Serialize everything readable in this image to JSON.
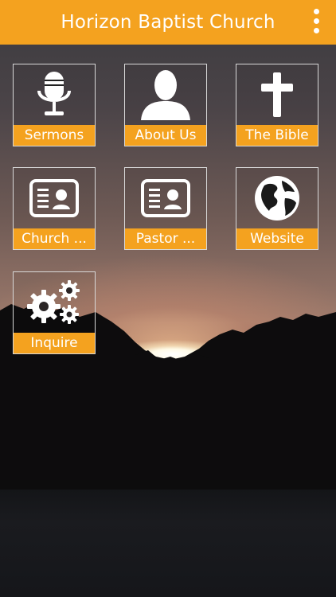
{
  "app": {
    "title": "Horizon Baptist Church",
    "accent_color": "#f4a21f",
    "menu_icon": "overflow-menu-icon"
  },
  "tiles": [
    {
      "label": "Sermons",
      "icon": "microphone-icon"
    },
    {
      "label": "About Us",
      "icon": "person-silhouette-icon"
    },
    {
      "label": "The Bible",
      "icon": "cross-icon"
    },
    {
      "label": "Church ...",
      "icon": "contact-card-icon"
    },
    {
      "label": "Pastor ...",
      "icon": "contact-card-icon"
    },
    {
      "label": "Website",
      "icon": "globe-icon"
    },
    {
      "label": "Inquire",
      "icon": "gears-icon"
    }
  ],
  "background": {
    "scene": "sunset-over-treeline"
  }
}
